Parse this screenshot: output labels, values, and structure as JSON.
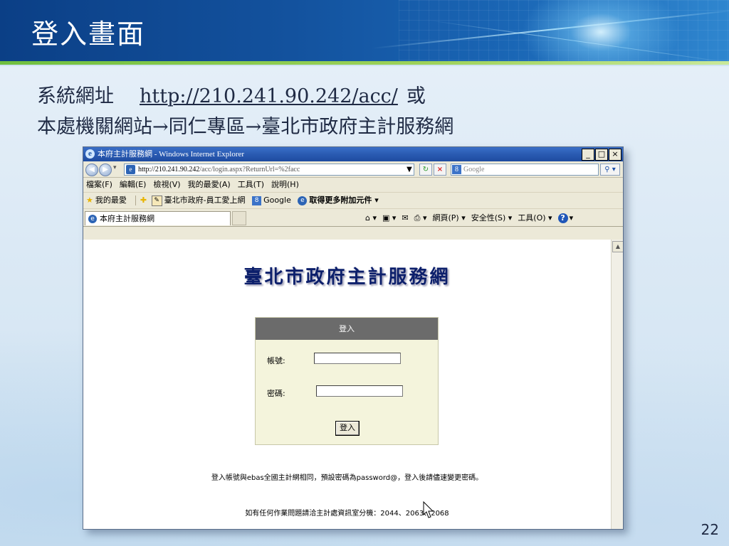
{
  "slide": {
    "title": "登入畫面",
    "line1_label": "系統網址",
    "line1_url": "http://210.241.90.242/acc/",
    "line1_suffix": "或",
    "line2": "本處機關網站→同仁專區→臺北市政府主計服務網",
    "page_number": "22"
  },
  "browser": {
    "window_title": "本府主計服務網 - Windows Internet Explorer",
    "window_buttons": [
      "_",
      "□",
      "×"
    ],
    "address": {
      "host": "http://210.241.90.242",
      "path": "/acc/login.aspx?ReturnUrl=%2facc"
    },
    "search_placeholder": "Google",
    "menu": [
      "檔案(F)",
      "編輯(E)",
      "檢視(V)",
      "我的最愛(A)",
      "工具(T)",
      "說明(H)"
    ],
    "favorites": {
      "label": "我的最愛",
      "item1": "臺北市政府-員工愛上網",
      "item2": "Google",
      "item3": "取得更多附加元件 ▾"
    },
    "tab_title": "本府主計服務網",
    "commands": {
      "page": "網頁(P) ▾",
      "safety": "安全性(S) ▾",
      "tools": "工具(O) ▾"
    }
  },
  "page": {
    "heading": "臺北市政府主計服務網",
    "login": {
      "header": "登入",
      "account_label": "帳號:",
      "password_label": "密碼:",
      "button_label": "登入",
      "account_value": "",
      "password_value": ""
    },
    "note1": "登入帳號與ebas全國主計網相同，預設密碼為password@，登入後請儘速變更密碼。",
    "note2": "如有任何作業問題請洽主計處資訊室分機：2044、2063、2068"
  },
  "colors": {
    "header_blue": "#13529e",
    "accent_green": "#8fcf4a",
    "heading_navy": "#0c1f6b",
    "login_bg": "#f4f4dc",
    "login_header_bg": "#6b6b6b"
  }
}
